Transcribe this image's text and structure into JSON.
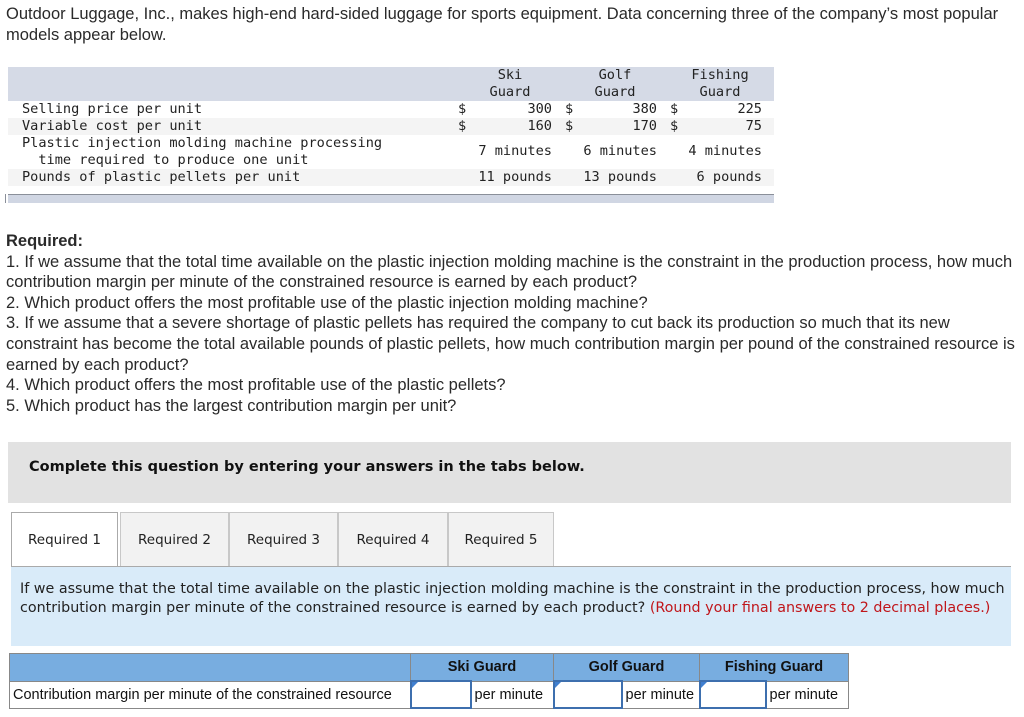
{
  "intro": "Outdoor Luggage, Inc., makes high-end hard-sided luggage for sports equipment. Data concerning three of the company’s most popular models appear below.",
  "data_table": {
    "columns": [
      {
        "line1": "Ski",
        "line2": "Guard"
      },
      {
        "line1": "Golf",
        "line2": "Guard"
      },
      {
        "line1": "Fishing",
        "line2": "Guard"
      }
    ],
    "currency_symbol": "$",
    "rows": [
      {
        "label": "Selling price per unit",
        "values": [
          "300",
          "380",
          "225"
        ],
        "currency": true
      },
      {
        "label": "Variable cost per unit",
        "values": [
          "160",
          "170",
          "75"
        ],
        "currency": true
      },
      {
        "label": "Plastic injection molding machine processing\n  time required to produce one unit",
        "values": [
          "7 minutes",
          "6 minutes",
          "4 minutes"
        ],
        "currency": false
      },
      {
        "label": "Pounds of plastic pellets per unit",
        "values": [
          "11 pounds",
          "13 pounds",
          "6 pounds"
        ],
        "currency": false
      }
    ]
  },
  "required": {
    "heading": "Required:",
    "items": [
      "1. If we assume that the total time available on the plastic injection molding machine is the constraint in the production process, how much contribution margin per minute of the constrained resource is earned by each product?",
      "2. Which product offers the most profitable use of the plastic injection molding machine?",
      "3. If we assume that a severe shortage of plastic pellets has required the company to cut back its production so much that its new constraint has become the total available pounds of plastic pellets, how much contribution margin per pound of the constrained resource is earned by each product?",
      "4. Which product offers the most profitable use of the plastic pellets?",
      "5. Which product has the largest contribution margin per unit?"
    ]
  },
  "instruction_banner": "Complete this question by entering your answers in the tabs below.",
  "tabs": [
    {
      "label": "Required 1",
      "active": true
    },
    {
      "label": "Required 2",
      "active": false
    },
    {
      "label": "Required 3",
      "active": false
    },
    {
      "label": "Required 4",
      "active": false
    },
    {
      "label": "Required 5",
      "active": false
    }
  ],
  "panel": {
    "question": "If we assume that the total time available on the plastic injection molding machine is the constraint in the production process, how much contribution margin per minute of the constrained resource is earned by each product?",
    "note": "(Round your final answers to 2 decimal places.)"
  },
  "answer_table": {
    "headers": [
      "Ski Guard",
      "Golf Guard",
      "Fishing Guard"
    ],
    "row_label": "Contribution margin per minute of the constrained resource",
    "inputs": [
      "",
      "",
      ""
    ],
    "unit": "per minute"
  },
  "colors": {
    "header_blue": "#78ade0",
    "panel_blue": "#d9ebf9",
    "note_red": "#c0161b",
    "table_header_gray": "#d5dae6"
  }
}
